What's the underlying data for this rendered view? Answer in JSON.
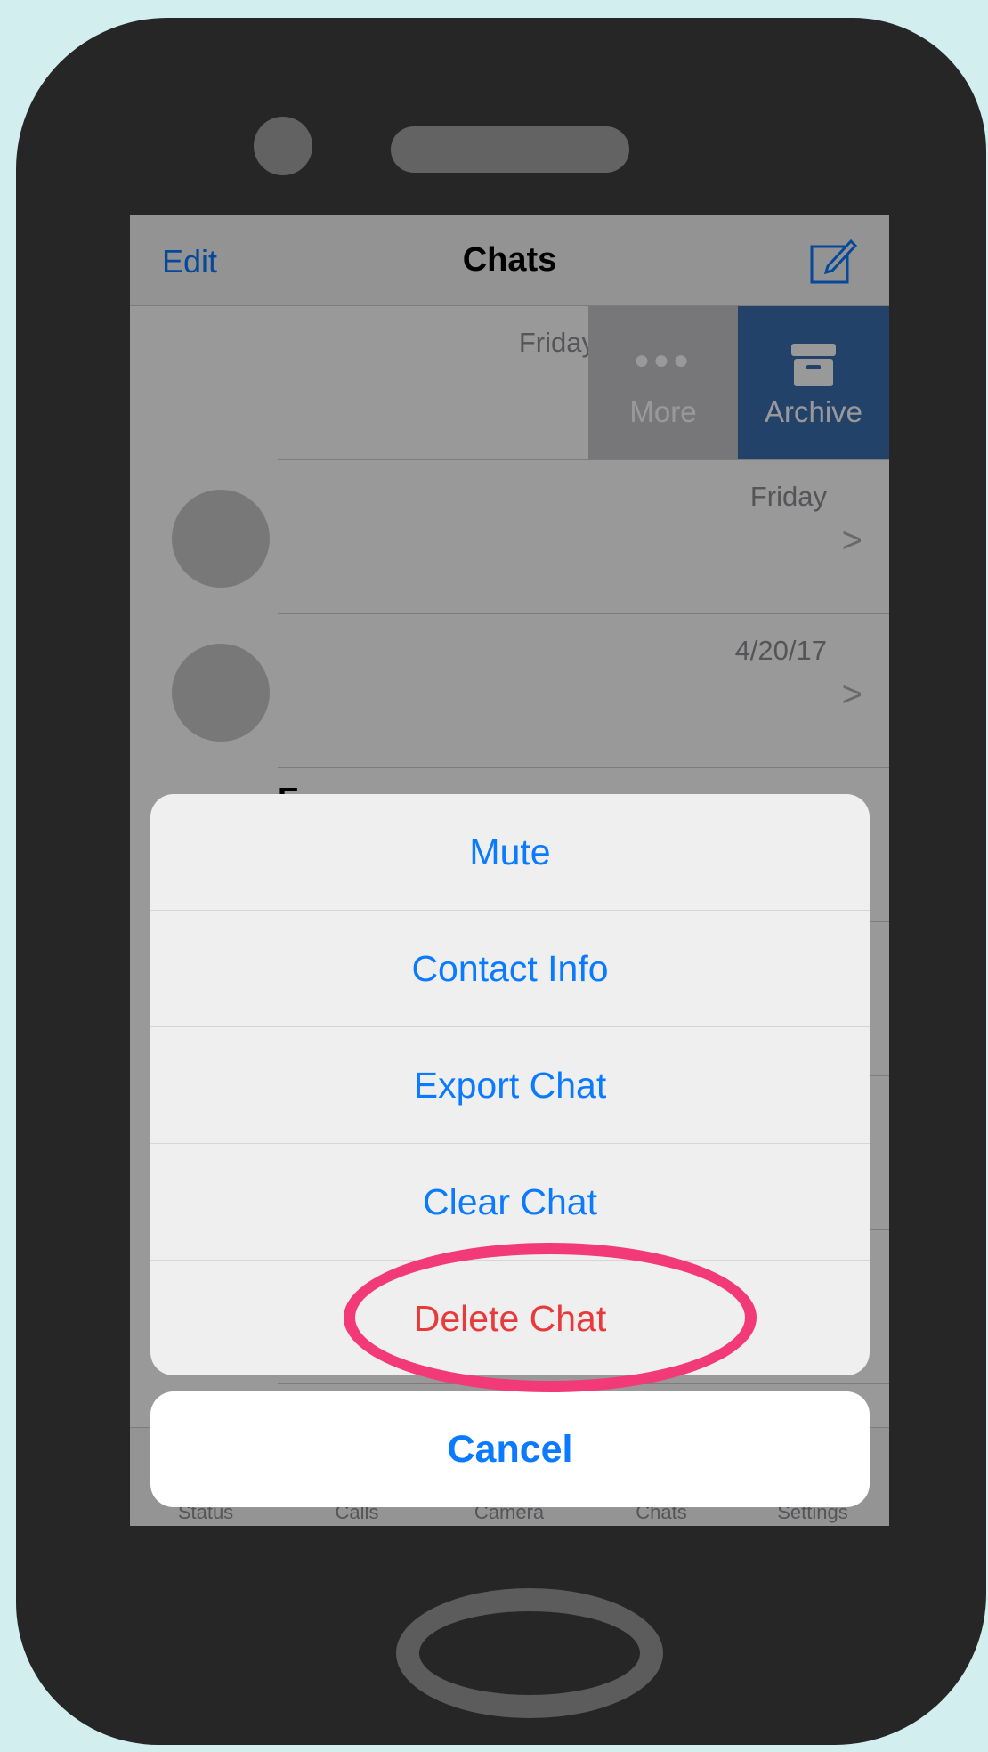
{
  "navbar": {
    "edit_label": "Edit",
    "title": "Chats"
  },
  "swipe_actions": {
    "more_label": "More",
    "archive_label": "Archive"
  },
  "chats": [
    {
      "time": "Friday",
      "chevron": ">"
    },
    {
      "time": "Friday",
      "chevron": ">"
    },
    {
      "time": "4/20/17",
      "chevron": ">"
    },
    {
      "name_peek": "E"
    }
  ],
  "tabbar": {
    "tabs": [
      "Status",
      "Calls",
      "Camera",
      "Chats",
      "Settings"
    ]
  },
  "action_sheet": {
    "items": [
      "Mute",
      "Contact Info",
      "Export Chat",
      "Clear Chat"
    ],
    "destructive": "Delete Chat",
    "cancel": "Cancel"
  },
  "colors": {
    "accent": "#0a7aff",
    "destructive": "#e8393b",
    "archive": "#3a6fb0",
    "annotation": "#f23a78",
    "background": "#d3eeee",
    "phone_body": "#262626"
  }
}
